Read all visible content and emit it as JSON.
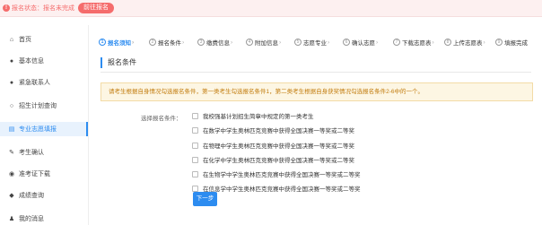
{
  "topbar": {
    "status_label": "报名状态：报名未完成",
    "action_label": "前往报名"
  },
  "sidebar": {
    "items": [
      {
        "label": "首页",
        "icon": "home-icon",
        "glyph": "⌂"
      },
      {
        "label": "基本信息",
        "icon": "user-icon",
        "glyph": "●"
      },
      {
        "label": "紧急联系人",
        "icon": "contact-icon",
        "glyph": "●"
      },
      {
        "label": "招生计划查询",
        "icon": "search-icon",
        "glyph": "○"
      },
      {
        "label": "专业志愿填报",
        "icon": "document-icon",
        "glyph": "▤"
      },
      {
        "label": "考生确认",
        "icon": "edit-icon",
        "glyph": "✎"
      },
      {
        "label": "准考证下载",
        "icon": "download-icon",
        "glyph": "◉"
      },
      {
        "label": "成绩查询",
        "icon": "score-icon",
        "glyph": "◆"
      },
      {
        "label": "我的消息",
        "icon": "message-icon",
        "glyph": "♟"
      }
    ]
  },
  "steps": [
    {
      "label": "报名须知"
    },
    {
      "label": "报名条件"
    },
    {
      "label": "缴费信息"
    },
    {
      "label": "附加信息"
    },
    {
      "label": "志愿专业"
    },
    {
      "label": "确认志愿"
    },
    {
      "label": "下载志愿表"
    },
    {
      "label": "上传志愿表"
    },
    {
      "label": "填报完成"
    }
  ],
  "section_title": "报名条件",
  "notice": "请考生根据自身情况勾选报名条件，第一类考生勾选报名条件1，第二类考生根据自身获奖情况勾选报名条件2-6中的一个。",
  "form": {
    "label": "选择报名条件：",
    "options": [
      "我校强基计划招生简章中规定的第一类考生",
      "在数学中学生奥林匹克竞赛中获得全国决赛一等奖或二等奖",
      "在物理中学生奥林匹克竞赛中获得全国决赛一等奖或二等奖",
      "在化学中学生奥林匹克竞赛中获得全国决赛一等奖或二等奖",
      "在生物学中学生奥林匹克竞赛中获得全国决赛一等奖或二等奖",
      "在信息学中学生奥林匹克竞赛中获得全国决赛一等奖或二等奖"
    ]
  },
  "next_label": "下一步",
  "colors": {
    "accent": "#2d8cf0",
    "danger": "#f56c6c",
    "warning_text": "#c27c0e",
    "warning_bg": "#fdf6e3"
  }
}
